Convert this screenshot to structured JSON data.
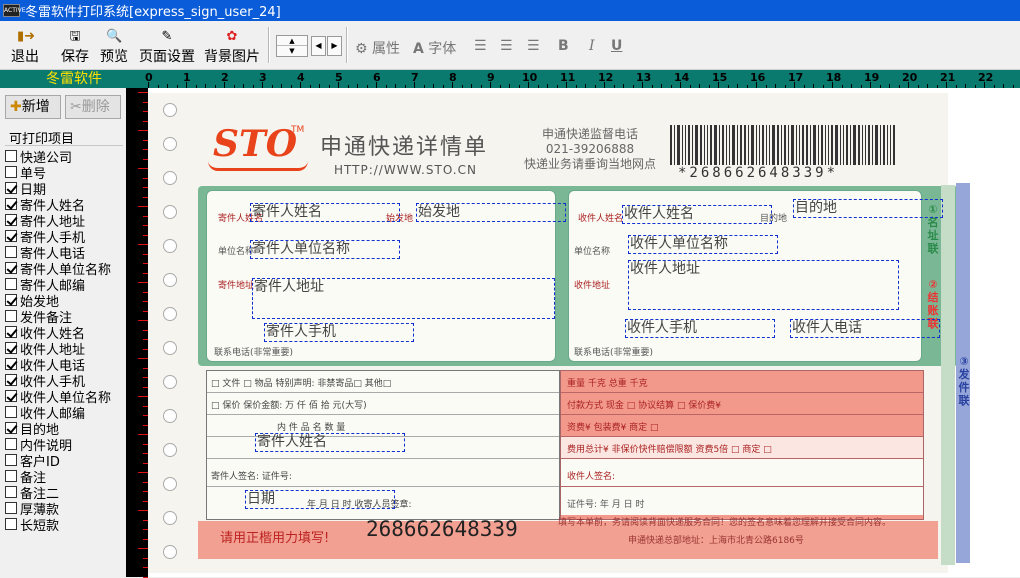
{
  "window": {
    "title": "冬雷软件打印系统[express_sign_user_24]",
    "app_icon_text": "ACTIVE"
  },
  "toolbar": {
    "exit": "退出",
    "save": "保存",
    "preview": "预览",
    "page_setup": "页面设置",
    "bg_image": "背景图片",
    "format": {
      "attr": "属性",
      "font": "字体",
      "bold": "B",
      "italic": "I",
      "underline": "U"
    }
  },
  "brand": "冬雷软件",
  "panel": {
    "add": "新增",
    "delete": "删除",
    "group_title": "可打印项目",
    "items": [
      {
        "label": "快递公司",
        "checked": false
      },
      {
        "label": "单号",
        "checked": false
      },
      {
        "label": "日期",
        "checked": true
      },
      {
        "label": "寄件人姓名",
        "checked": true
      },
      {
        "label": "寄件人地址",
        "checked": true
      },
      {
        "label": "寄件人手机",
        "checked": true
      },
      {
        "label": "寄件人电话",
        "checked": false
      },
      {
        "label": "寄件人单位名称",
        "checked": true
      },
      {
        "label": "寄件人邮编",
        "checked": false
      },
      {
        "label": "始发地",
        "checked": true
      },
      {
        "label": "发件备注",
        "checked": false
      },
      {
        "label": "收件人姓名",
        "checked": true
      },
      {
        "label": "收件人地址",
        "checked": true
      },
      {
        "label": "收件人电话",
        "checked": true
      },
      {
        "label": "收件人手机",
        "checked": true
      },
      {
        "label": "收件人单位名称",
        "checked": true
      },
      {
        "label": "收件人邮编",
        "checked": false
      },
      {
        "label": "目的地",
        "checked": true
      },
      {
        "label": "内件说明",
        "checked": false
      },
      {
        "label": "客户ID",
        "checked": false
      },
      {
        "label": "备注",
        "checked": false
      },
      {
        "label": "备注二",
        "checked": false
      },
      {
        "label": "厚薄款",
        "checked": false
      },
      {
        "label": "长短款",
        "checked": false
      }
    ]
  },
  "ruler": {
    "labels": [
      "0",
      "1",
      "2",
      "3",
      "4",
      "5",
      "6",
      "7",
      "8",
      "9",
      "10",
      "11",
      "12",
      "13",
      "14",
      "15",
      "16",
      "17",
      "18",
      "19",
      "20",
      "21",
      "22"
    ]
  },
  "slip": {
    "logo": "STO",
    "tm": "TM",
    "title": "申通快递详情单",
    "url": "HTTP://WWW.STO.CN",
    "hotline_1": "申通快递监督电话",
    "hotline_2": "021-39206888",
    "hotline_3": "快递业务请垂询当地网点",
    "barcode_number": "*268662648339*",
    "tracking": "268662648339",
    "hint": "请用正楷用力填写!",
    "labels": {
      "sender": "寄件人姓名",
      "origin": "始发地",
      "unit": "单位名称",
      "addr": "寄件地址",
      "tel": "联系电话(非常重要)",
      "recv": "收件人姓名",
      "dest": "目的地",
      "runit": "单位名称",
      "raddr": "收件地址",
      "rtel": "联系电话(非常重要)",
      "doc": "□ 文件    □ 物品    特别声明: 非禁寄品□    其他□",
      "insure": "□ 保价  保价金额:   万  仟  佰  拾  元(大写)",
      "content": "内 件 品 名        数 量",
      "sign": "寄件人签名:            证件号:",
      "date": "年  月  日  时    收寄人员签章:",
      "weight": "重量        千克  总重        千克",
      "pay": "付款方式    现金 □    协议结算 □    保价费¥",
      "fee": "资费¥                  包装费¥       商定 □",
      "total": "费用总计¥         非保价快件赔偿限额    资费5倍 □ 商定 □",
      "rsign": "收件人签名:",
      "rdate": "证件号:          年   月   日   时",
      "footer_1": "填写本单前，务请阅读背面快递服务合同！您的签名意味着您理解并接受合同内容。",
      "footer_2": "申通快递总部地址：上海市北青公路6186号",
      "copy1": "①名址联",
      "copy2": "②结账联",
      "copy3": "③发件联"
    }
  },
  "fields": {
    "sender_name": "寄件人姓名",
    "origin": "始发地",
    "sender_unit": "寄件人单位名称",
    "sender_addr": "寄件人地址",
    "sender_mobile": "寄件人手机",
    "recv_name": "收件人姓名",
    "dest": "目的地",
    "recv_unit": "收件人单位名称",
    "recv_addr": "收件人地址",
    "recv_mobile": "收件人手机",
    "recv_tel": "收件人电话",
    "content_sender": "寄件人姓名",
    "date": "日期"
  }
}
